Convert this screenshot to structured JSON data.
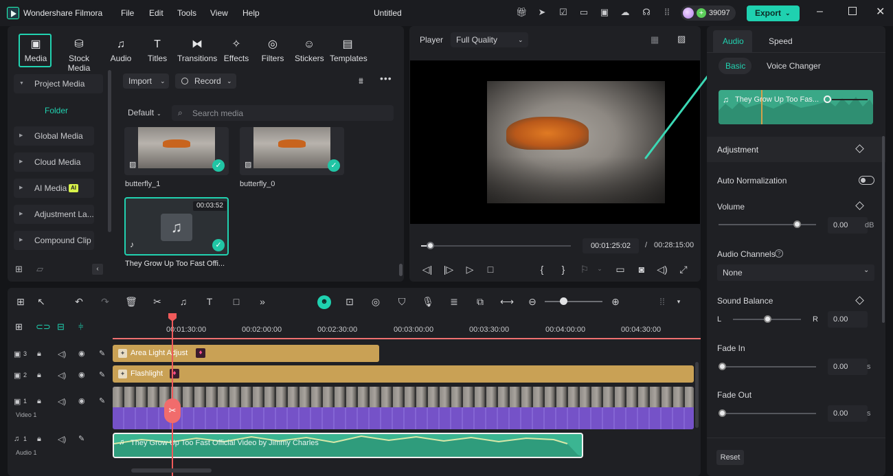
{
  "app": {
    "name": "Wondershare Filmora",
    "project_title": "Untitled"
  },
  "menu": [
    "File",
    "Edit",
    "Tools",
    "View",
    "Help"
  ],
  "credits": "39097",
  "export_label": "Export",
  "toolbar": [
    {
      "label": "Media",
      "icon": "media-icon"
    },
    {
      "label": "Stock Media",
      "icon": "stock-media-icon"
    },
    {
      "label": "Audio",
      "icon": "audio-note-icon"
    },
    {
      "label": "Titles",
      "icon": "titles-icon"
    },
    {
      "label": "Transitions",
      "icon": "transitions-icon"
    },
    {
      "label": "Effects",
      "icon": "effects-icon"
    },
    {
      "label": "Filters",
      "icon": "filters-icon"
    },
    {
      "label": "Stickers",
      "icon": "stickers-icon"
    },
    {
      "label": "Templates",
      "icon": "templates-icon"
    }
  ],
  "sidebar": {
    "project_media": "Project Media",
    "folder": "Folder",
    "items": [
      "Global Media",
      "Cloud Media",
      "AI Media",
      "Adjustment La...",
      "Compound Clip"
    ],
    "ai_badge": "AI"
  },
  "media_bar": {
    "import": "Import",
    "record": "Record",
    "sort": "Default",
    "search_placeholder": "Search media"
  },
  "media_items": [
    {
      "name": "butterfly_1"
    },
    {
      "name": "butterfly_0"
    },
    {
      "name": "They Grow Up Too Fast  Offi...",
      "duration": "00:03:52"
    }
  ],
  "player": {
    "label": "Player",
    "quality": "Full Quality",
    "current_time": "00:01:25:02",
    "separator": "/",
    "total_time": "00:28:15:00",
    "progress": 0.06
  },
  "right_panel": {
    "tabs": [
      "Audio",
      "Speed"
    ],
    "subtabs": [
      "Basic",
      "Voice Changer"
    ],
    "clip_title": "They Grow Up Too Fas...",
    "adjustment": "Adjustment",
    "auto_normalization": "Auto Normalization",
    "volume": {
      "label": "Volume",
      "value": "0.00",
      "unit": "dB",
      "level": 0.8
    },
    "audio_channels": {
      "label": "Audio Channels",
      "value": "None"
    },
    "sound_balance": {
      "label": "Sound Balance",
      "left": "L",
      "right": "R",
      "value": "0.00",
      "level": 0.5
    },
    "fade_in": {
      "label": "Fade In",
      "value": "0.00",
      "unit": "s"
    },
    "fade_out": {
      "label": "Fade Out",
      "value": "0.00",
      "unit": "s"
    },
    "reset": "Reset"
  },
  "timeline": {
    "ruler": [
      "00:01:30:00",
      "00:02:00:00",
      "00:02:30:00",
      "00:03:00:00",
      "00:03:30:00",
      "00:04:00:00",
      "00:04:30:00"
    ],
    "tracks": [
      {
        "num": "3",
        "clip": "Area Light Adjust"
      },
      {
        "num": "2",
        "clip": "Flashlight"
      },
      {
        "num": "1",
        "name": "Video 1"
      },
      {
        "num": "1",
        "name": "Audio 1",
        "clip": "They Grow Up Too Fast  Official Video by Jimmy Charles"
      }
    ]
  },
  "colors": {
    "accent": "#1fd1b0",
    "adjust_clip": "#c9a155",
    "video_clip": "#7552c8",
    "audio_clip": "#3bb592",
    "playhead": "#f05a5a"
  }
}
